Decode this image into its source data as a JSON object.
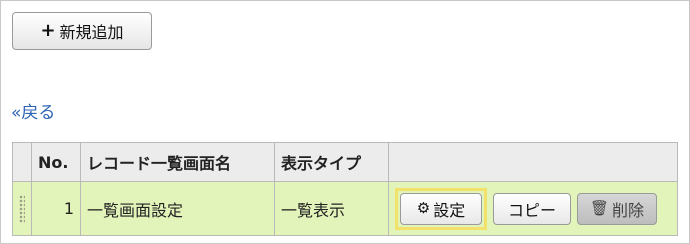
{
  "toolbar": {
    "add_label": "新規追加"
  },
  "back_link": "«戻る",
  "table": {
    "headers": {
      "no": "No.",
      "name": "レコード一覧画面名",
      "type": "表示タイプ"
    },
    "rows": [
      {
        "no": "1",
        "name": "一覧画面設定",
        "type": "一覧表示",
        "actions": {
          "settings": "設定",
          "copy": "コピー",
          "delete": "削除"
        }
      }
    ]
  },
  "icons": {
    "add": "plus-icon",
    "settings": "gear-icon",
    "delete": "trash-icon"
  },
  "colors": {
    "row_background": "#e3f4ba",
    "header_background": "#ececec",
    "link": "#2a62b5",
    "highlight": "#f2e16b"
  }
}
